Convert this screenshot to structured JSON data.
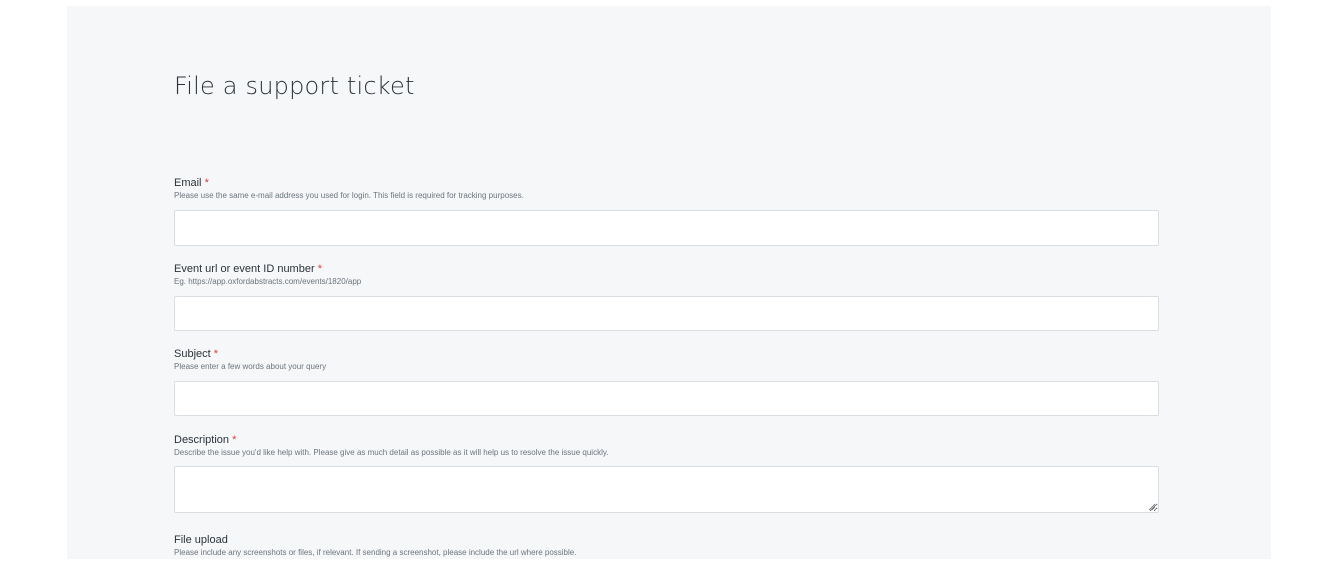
{
  "form": {
    "title": "File a support ticket",
    "required_marker": "*",
    "fields": [
      {
        "label": "Email",
        "help": "Please use the same e-mail address you used for login. This field is required for tracking purposes.",
        "value": "",
        "required": true
      },
      {
        "label": "Event url or event ID number",
        "help": "Eg. https://app.oxfordabstracts.com/events/1820/app",
        "value": "",
        "required": true
      },
      {
        "label": "Subject",
        "help": "Please enter a few words about your query",
        "value": "",
        "required": true
      },
      {
        "label": "Description",
        "help": "Describe the issue you'd like help with.  Please give as much detail as possible as it will help us to resolve the issue quickly.",
        "value": "",
        "required": true
      },
      {
        "label": "File upload",
        "help": "Please include any screenshots or files, if relevant. If sending a screenshot, please include the url where possible.",
        "required": false
      }
    ]
  },
  "icons": {
    "resize": "resize-grip-icon"
  },
  "colors": {
    "panel_background": "#f5f7f9",
    "required_marker": "#e23b3b",
    "input_border": "#d9dee3"
  }
}
